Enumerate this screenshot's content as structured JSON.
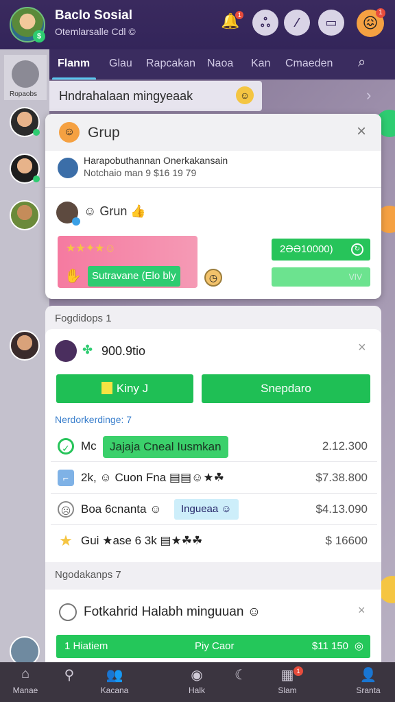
{
  "header": {
    "title": "Baclo Sosial",
    "subtitle": "Otemlarsalle Cdl ©",
    "notif_count": "1",
    "emoji_badge": "1"
  },
  "tabs": [
    {
      "label": "Flanm",
      "active": true
    },
    {
      "label": "Glau"
    },
    {
      "label": "Rapcakan"
    },
    {
      "label": "Naoa"
    },
    {
      "label": "Kan"
    },
    {
      "label": "Cmaeden"
    }
  ],
  "rail": {
    "top_label": "Ropaobs"
  },
  "search_strip": {
    "text": "Hndrahalaan mingyeaak"
  },
  "group_card": {
    "title": "Grup",
    "sub_line1": "Harapobuthannan Onerkakansain",
    "sub_line2": "Notchaio man 9  $16 19 79",
    "grun_label": "Grun",
    "promo_label": "Sutravane (Elo bly",
    "price_label": "2ƏƏ10000)",
    "bar_label": "VIV"
  },
  "section2": {
    "title": "Fogdidops 1",
    "amount": "900.9tio",
    "btn_left": "Kiny J",
    "btn_right": "Snepdaro",
    "list_title": "Nerdorkerdinge: 7",
    "rows": [
      {
        "prefix": "Mc",
        "chip": "Jajaja Cneal Iusmkan",
        "value": "2.12.300"
      },
      {
        "prefix": "2k,",
        "text": "Cuon  Fna",
        "value": "$7.38.800"
      },
      {
        "prefix": "Boa 6cnanta",
        "chip": "Ingueaa",
        "value": "$4.13.090"
      },
      {
        "prefix": "Gui",
        "text": "ase 6  3k",
        "value": "$ 16600"
      }
    ]
  },
  "section3": {
    "title": "Ngodakanps 7",
    "row_text": "Fotkahrid Halabh minguuan",
    "bottom_left": "1 Hiatiem",
    "bottom_mid": "Piy Caor",
    "bottom_right": "$11 150"
  },
  "bottom_nav": [
    {
      "label": "Manae",
      "icon": "home-icon"
    },
    {
      "label": "",
      "icon": "search-icon"
    },
    {
      "label": "Kacana",
      "icon": "people-icon"
    },
    {
      "label": "Halk",
      "icon": "camera-icon"
    },
    {
      "label": "",
      "icon": "moon-icon"
    },
    {
      "label": "Slam",
      "icon": "gift-icon",
      "badge": "1"
    },
    {
      "label": "Sranta",
      "icon": "profile-icon"
    }
  ],
  "colors": {
    "header_bg": "#3a2a5e",
    "accent_green": "#24c75a",
    "accent_blue": "#5ac8f0"
  }
}
